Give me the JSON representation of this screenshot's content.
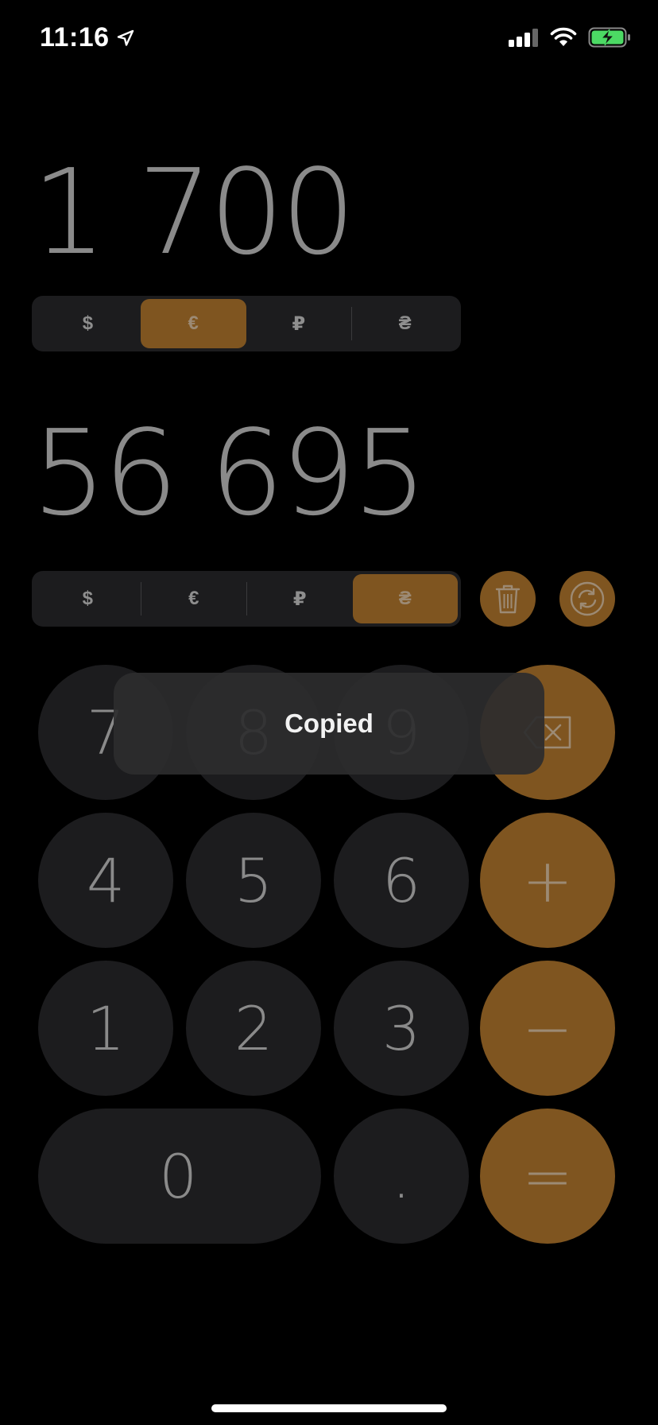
{
  "status_bar": {
    "time": "11:16",
    "icons": [
      "location-arrow-icon",
      "cellular-signal-icon",
      "wifi-icon",
      "battery-charging-icon"
    ],
    "battery_color": "#4cd964"
  },
  "converter": {
    "source_value": "1 700",
    "source_currencies": [
      "$",
      "€",
      "₽",
      "₴"
    ],
    "source_selected": "€",
    "target_value": "56 695",
    "target_currencies": [
      "$",
      "€",
      "₽",
      "₴"
    ],
    "target_selected": "₴",
    "actions": [
      "trash-icon",
      "swap-icon"
    ]
  },
  "keypad": {
    "row1": [
      "7",
      "8",
      "9",
      "backspace-icon"
    ],
    "row2": [
      "4",
      "5",
      "6",
      "+"
    ],
    "row3": [
      "1",
      "2",
      "3",
      "−"
    ],
    "row4": [
      "0",
      ".",
      "="
    ]
  },
  "toast": {
    "message": "Copied"
  },
  "colors": {
    "accent": "#7f5520",
    "key_background": "#1c1c1e",
    "background": "#000000"
  }
}
